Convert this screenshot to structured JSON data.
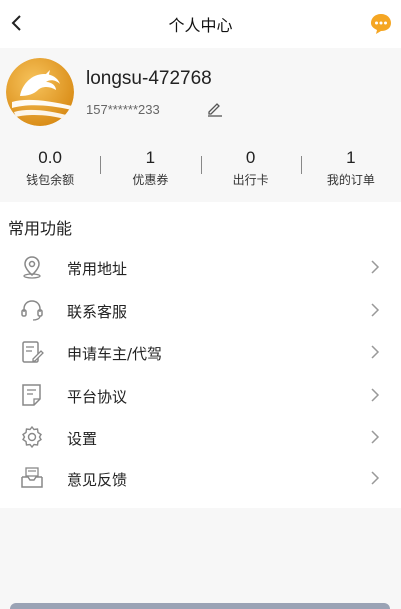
{
  "nav": {
    "title": "个人中心",
    "back_icon": "chevron-left-icon",
    "message_icon": "chat-bubble-icon",
    "accent": "#f5a623"
  },
  "profile": {
    "username": "longsu-472768",
    "phone": "157******233",
    "edit_icon": "pencil-icon",
    "avatar_icon": "dragon-logo"
  },
  "stats": [
    {
      "value": "0.0",
      "label": "钱包余额"
    },
    {
      "value": "1",
      "label": "优惠券"
    },
    {
      "value": "0",
      "label": "出行卡"
    },
    {
      "value": "1",
      "label": "我的订单"
    }
  ],
  "functions": {
    "title": "常用功能",
    "items": [
      {
        "label": "常用地址",
        "icon": "location-pin-icon"
      },
      {
        "label": "联系客服",
        "icon": "headset-icon"
      },
      {
        "label": "申请车主/代驾",
        "icon": "edit-document-icon"
      },
      {
        "label": "平台协议",
        "icon": "document-icon"
      },
      {
        "label": "设置",
        "icon": "gear-icon"
      },
      {
        "label": "意见反馈",
        "icon": "feedback-inbox-icon"
      }
    ]
  }
}
